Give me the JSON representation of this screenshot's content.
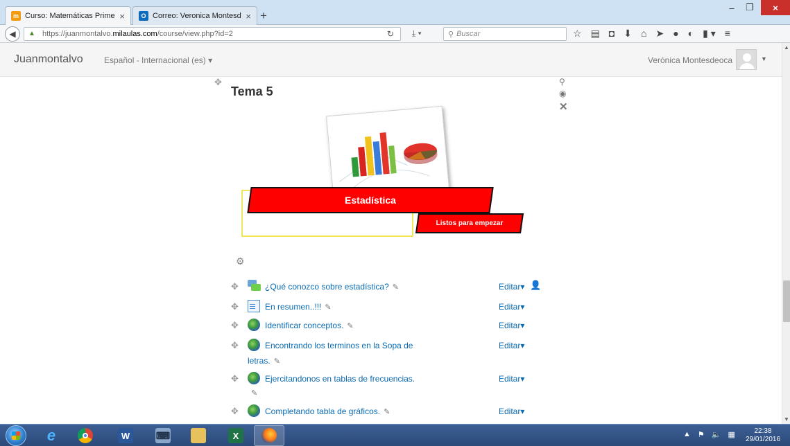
{
  "browser": {
    "tabs": [
      {
        "title": "Curso: Matemáticas Prime...",
        "active": true
      },
      {
        "title": "Correo: Veronica Montesd...",
        "active": false
      }
    ],
    "new_tab": "+",
    "url_prefix": "https://juanmontalvo.",
    "url_domain": "milaulas.com",
    "url_path": "/course/view.php?id=2",
    "search_placeholder": "Buscar"
  },
  "moodle_header": {
    "site_name": "Juanmontalvo",
    "language": "Español - Internacional (es) ▾",
    "user_name": "Verónica Montesdeoca"
  },
  "section": {
    "title": "Tema 5",
    "banner_title": "Estadística",
    "banner_subtitle": "Listos para empezar"
  },
  "activities": [
    {
      "type": "forum-icon",
      "label": "¿Qué conozco sobre estadística?",
      "edit": "Editar▾",
      "has_user_icon": true
    },
    {
      "type": "page-icon",
      "label": "En resumen..!!!",
      "edit": "Editar▾"
    },
    {
      "type": "url-icon",
      "label": "Identificar conceptos.",
      "edit": "Editar▾"
    },
    {
      "type": "url-icon",
      "label": "Encontrando los terminos en la Sopa de",
      "label_line2": "letras.",
      "edit": "Editar▾"
    },
    {
      "type": "url-icon",
      "label": "Ejercitandonos en tablas de frecuencias.",
      "edit": "Editar▾"
    },
    {
      "type": "url-icon",
      "label": "Completando tabla de gráficos.",
      "edit": "Editar▾"
    }
  ],
  "taskbar": {
    "time": "22:38",
    "date": "29/01/2016"
  },
  "colors": {
    "link": "#0a6ab2",
    "banner_red": "#ff0000",
    "banner_yellow": "#f2e55a",
    "taskbar": "#2b4a7a"
  }
}
